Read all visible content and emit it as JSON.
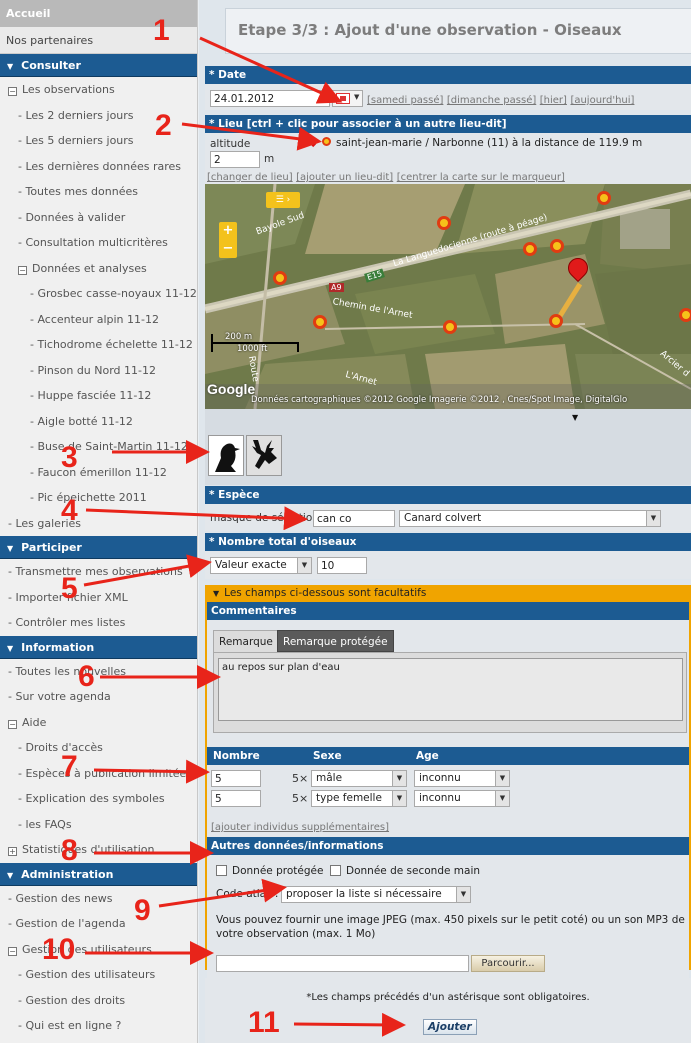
{
  "sidebar": {
    "top": "Accueil",
    "top2": "Nos partenaires",
    "sections": [
      {
        "title": "Consulter",
        "items": [
          {
            "label": "Les observations",
            "level": 1,
            "toggle": "−"
          },
          {
            "label": "- Les 2 derniers jours",
            "level": 2
          },
          {
            "label": "- Les 5 derniers jours",
            "level": 2
          },
          {
            "label": "- Les dernières données rares",
            "level": 2
          },
          {
            "label": "- Toutes mes données",
            "level": 2
          },
          {
            "label": "- Données à valider",
            "level": 2
          },
          {
            "label": "- Consultation multicritères",
            "level": 2
          },
          {
            "label": "Données et analyses",
            "level": 2,
            "toggle": "−"
          },
          {
            "label": "- Grosbec casse-noyaux 11-12",
            "level": 3
          },
          {
            "label": "- Accenteur alpin 11-12",
            "level": 3
          },
          {
            "label": "- Tichodrome échelette 11-12",
            "level": 3
          },
          {
            "label": "- Pinson du Nord 11-12",
            "level": 3
          },
          {
            "label": "- Huppe fasciée 11-12",
            "level": 3
          },
          {
            "label": "- Aigle botté 11-12",
            "level": 3
          },
          {
            "label": "- Buse de Saint-Martin 11-12",
            "level": 3
          },
          {
            "label": "- Faucon émerillon 11-12",
            "level": 3
          },
          {
            "label": "- Pic épeichette 2011",
            "level": 3
          },
          {
            "label": "- Les galeries",
            "level": 1
          }
        ]
      },
      {
        "title": "Participer",
        "items": [
          {
            "label": "- Transmettre mes observations",
            "level": 1
          },
          {
            "label": "- Importer fichier XML",
            "level": 1
          },
          {
            "label": "- Contrôler mes listes",
            "level": 1
          }
        ]
      },
      {
        "title": "Information",
        "items": [
          {
            "label": "- Toutes les nouvelles",
            "level": 1
          },
          {
            "label": "- Sur votre agenda",
            "level": 1
          },
          {
            "label": "Aide",
            "level": 1,
            "toggle": "−"
          },
          {
            "label": "- Droits d'accès",
            "level": 2
          },
          {
            "label": "- Espèces à publication limitée",
            "level": 2
          },
          {
            "label": "- Explication des symboles",
            "level": 2
          },
          {
            "label": "- les FAQs",
            "level": 2
          },
          {
            "label": "Statistiques d'utilisation",
            "level": 1,
            "toggle": "+"
          }
        ]
      },
      {
        "title": "Administration",
        "items": [
          {
            "label": "- Gestion des news",
            "level": 1
          },
          {
            "label": "- Gestion de l'agenda",
            "level": 1
          },
          {
            "label": "Gestion des utilisateurs",
            "level": 1,
            "toggle": "−"
          },
          {
            "label": "- Gestion des utilisateurs",
            "level": 2
          },
          {
            "label": "- Gestion des droits",
            "level": 2
          },
          {
            "label": "- Qui est en ligne ?",
            "level": 2
          }
        ]
      }
    ]
  },
  "page": {
    "title": "Etape 3/3 : Ajout d'une observation - Oiseaux"
  },
  "date": {
    "header": "* Date",
    "value": "24.01.2012",
    "links": [
      "[samedi passé]",
      "[dimanche passé]",
      "[hier]",
      "[aujourd'hui]"
    ]
  },
  "lieu": {
    "header": "* Lieu [ctrl + clic pour associer à un autre lieu-dit]",
    "altitude_label": "altitude",
    "altitude_value": "2",
    "altitude_unit": "m",
    "place_text": "saint-jean-marie / Narbonne (11) à la distance de 119.9 m",
    "links": [
      "[changer de lieu]",
      "[ajouter un lieu-dit]",
      "[centrer la carte sur le marqueur]"
    ]
  },
  "map": {
    "labels": {
      "road1": "La Languedocienne (route à péage)",
      "road2": "E15",
      "road3": "A9",
      "road4": "Chemin de l'Arnet",
      "road5": "L'Arnet",
      "road6": "Route",
      "road7": "Bayole Sud",
      "road8": "Arcier d"
    },
    "scale_m": "200 m",
    "scale_ft": "1000 ft",
    "logo": "Google",
    "attribution": "Données cartographiques ©2012 Google Imagerie ©2012 , Cnes/Spot Image, DigitalGlo",
    "zoom_plus": "+",
    "zoom_minus": "−"
  },
  "espece": {
    "header": "* Espèce",
    "mask_label": "masque de sélection",
    "mask_value": "can co",
    "species": "Canard colvert"
  },
  "nombre": {
    "header": "* Nombre total d'oiseaux",
    "type": "Valeur exacte",
    "value": "10"
  },
  "optional": {
    "header": "Les champs ci-dessous sont facultatifs"
  },
  "comments": {
    "header": "Commentaires",
    "tabs": [
      "Remarque",
      "Remarque protégée"
    ],
    "text": "au repos sur plan d'eau"
  },
  "details": {
    "columns": [
      "Nombre",
      "Sexe",
      "Age"
    ],
    "multiplier": "5×",
    "rows": [
      {
        "nombre": "5",
        "sexe": "mâle",
        "age": "inconnu"
      },
      {
        "nombre": "5",
        "sexe": "type femelle",
        "age": "inconnu"
      }
    ],
    "add_link": "[ajouter individus supplémentaires]"
  },
  "autres": {
    "header": "Autres données/informations",
    "cb_protected": "Donnée protégée",
    "cb_second_hand": "Donnée de seconde main",
    "atlas_label": "Code atlas :",
    "atlas_value": "proposer la liste si nécessaire",
    "upload_text": "Vous pouvez fournir une image JPEG (max. 450 pixels sur le petit coté) ou un son MP3 de votre observation (max. 1 Mo)",
    "browse": "Parcourir..."
  },
  "footer": {
    "note": "*Les champs précédés d'un astérisque sont obligatoires.",
    "submit": "Ajouter"
  },
  "annotations": [
    "1",
    "2",
    "3",
    "4",
    "5",
    "6",
    "7",
    "8",
    "9",
    "10",
    "11"
  ]
}
